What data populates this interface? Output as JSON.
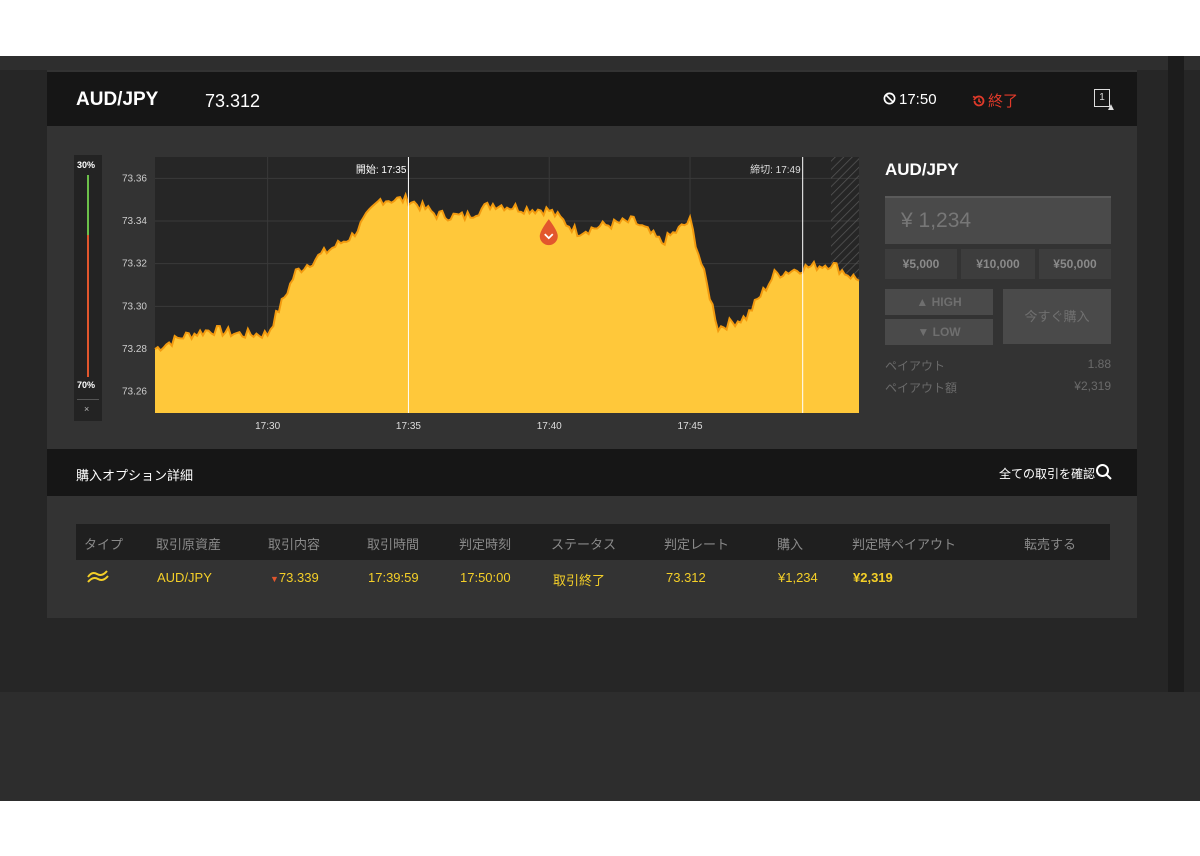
{
  "header": {
    "pair": "AUD/JPY",
    "price": "73.312",
    "timer": "17:50",
    "ended": "終了",
    "expand_label": "1"
  },
  "gauge": {
    "top_pct": "30%",
    "bottom_pct": "70%",
    "close": "×",
    "high_share": 0.3
  },
  "chart": {
    "start_label": "開始: 17:35",
    "end_label": "締切: 17:49",
    "y_ticks": [
      "73.36",
      "73.34",
      "73.32",
      "73.30",
      "73.28",
      "73.26"
    ],
    "x_ticks": [
      "17:30",
      "17:35",
      "17:40",
      "17:45"
    ]
  },
  "chart_data": {
    "type": "area",
    "title": "",
    "xlabel": "",
    "ylabel": "",
    "x_range": [
      "17:26",
      "17:51"
    ],
    "ylim": [
      73.25,
      73.37
    ],
    "series": [
      {
        "x": [
          "17:26",
          "17:27",
          "17:28",
          "17:29",
          "17:30",
          "17:31",
          "17:32",
          "17:33",
          "17:34",
          "17:35",
          "17:36",
          "17:37",
          "17:38",
          "17:39",
          "17:40",
          "17:41",
          "17:42",
          "17:43",
          "17:44",
          "17:45",
          "17:46",
          "17:47",
          "17:48",
          "17:49",
          "17:50",
          "17:51"
        ],
        "values": [
          73.28,
          73.286,
          73.289,
          73.287,
          73.287,
          73.316,
          73.325,
          73.333,
          73.35,
          73.35,
          73.343,
          73.342,
          73.348,
          73.346,
          73.345,
          73.335,
          73.338,
          73.34,
          73.33,
          73.34,
          73.29,
          73.295,
          73.315,
          73.318,
          73.32,
          73.312
        ]
      }
    ],
    "marker": {
      "time": "17:39:59",
      "rate": 73.339,
      "direction": "low"
    },
    "start_time": "17:35",
    "end_time": "17:49",
    "grid": true
  },
  "trade": {
    "pair": "AUD/JPY",
    "amount": "¥ 1,234",
    "presets": [
      "¥5,000",
      "¥10,000",
      "¥50,000"
    ],
    "high": "HIGH",
    "low": "LOW",
    "buy": "今すぐ購入",
    "payout_label": "ペイアウト",
    "payout_value": "1.88",
    "payout_amount_label": "ペイアウト額",
    "payout_amount_value": "¥2,319"
  },
  "detail": {
    "title": "購入オプション詳細",
    "confirm": "全ての取引を確認"
  },
  "table": {
    "headers": [
      "タイプ",
      "取引原資産",
      "取引内容",
      "取引時間",
      "判定時刻",
      "ステータス",
      "判定レート",
      "購入",
      "判定時ペイアウト",
      "転売する"
    ],
    "row": {
      "asset": "AUD/JPY",
      "content": "73.339",
      "time": "17:39:59",
      "judge_time": "17:50:00",
      "status": "取引終了",
      "rate": "73.312",
      "purchase": "¥1,234",
      "payout": "¥2,319"
    }
  },
  "colors": {
    "accent": "#f4cf28",
    "area_fill": "#ffc83a",
    "area_line": "#f29a0f",
    "ended": "#e03a2a",
    "marker": "#e2562d"
  }
}
